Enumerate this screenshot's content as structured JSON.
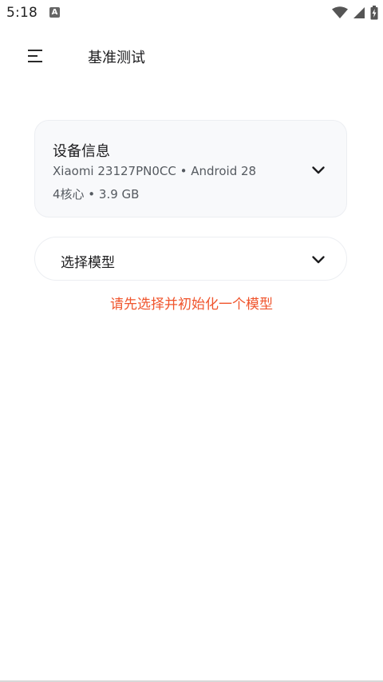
{
  "status_bar": {
    "time": "5:18",
    "notification_icon": "a-icon",
    "wifi_icon": "wifi-icon",
    "signal_icon": "signal-icon",
    "battery_icon": "battery-icon"
  },
  "app_bar": {
    "menu_icon": "menu-icon",
    "title": "基准测试"
  },
  "device_info": {
    "title": "设备信息",
    "line1": "Xiaomi 23127PN0CC • Android 28",
    "line2": "4核心 • 3.9 GB",
    "expand_icon": "chevron-down-icon"
  },
  "model_selector": {
    "label": "选择模型",
    "expand_icon": "chevron-down-icon"
  },
  "warning": {
    "text": "请先选择并初始化一个模型",
    "color": "#f0552d"
  }
}
